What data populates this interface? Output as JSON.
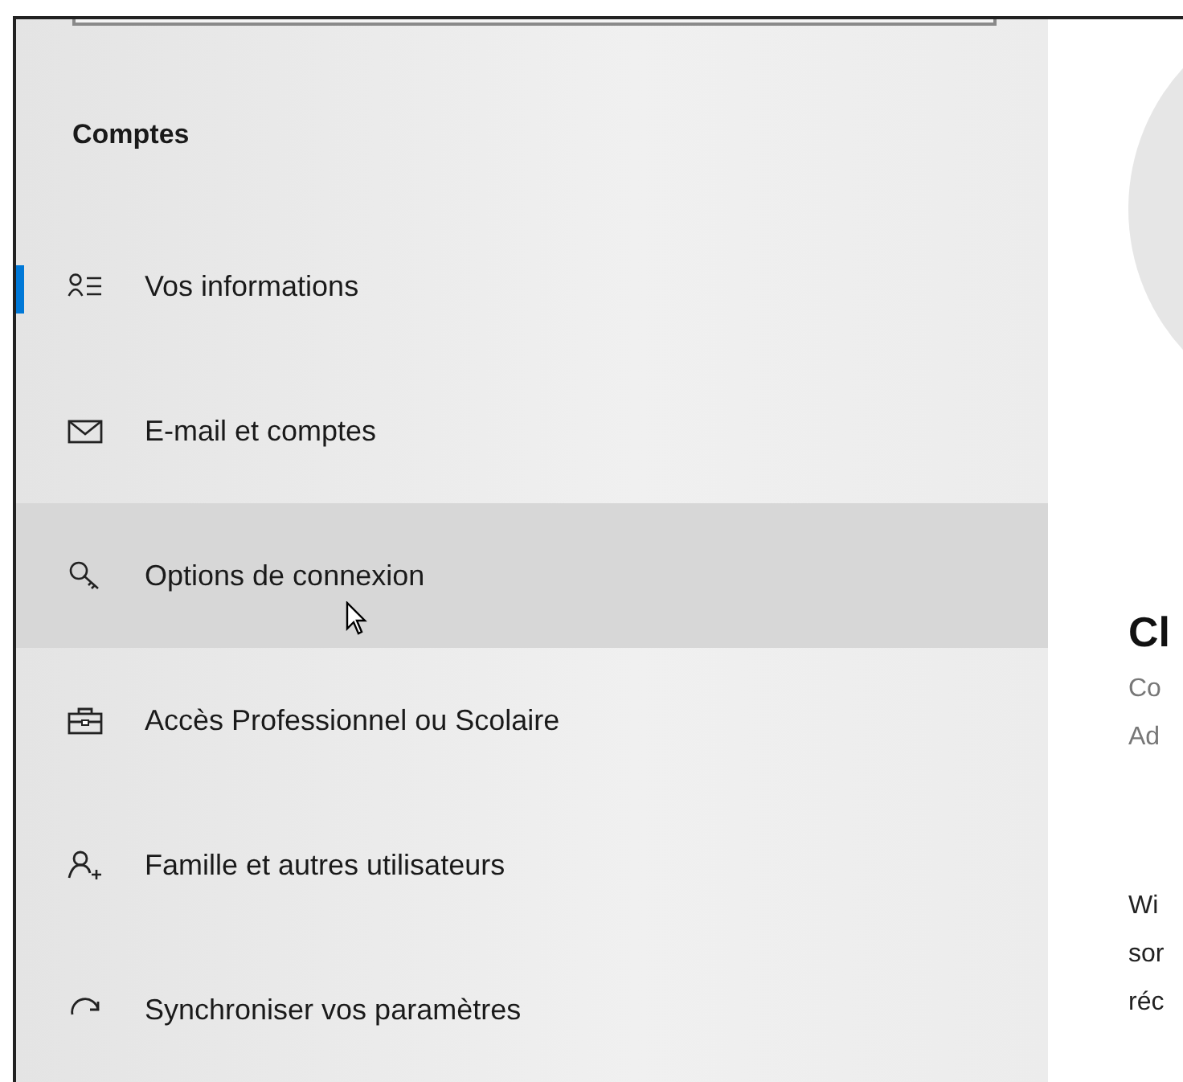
{
  "sidebar": {
    "heading": "Comptes",
    "items": [
      {
        "label": "Vos informations",
        "selected": true,
        "hovered": false
      },
      {
        "label": "E-mail et comptes",
        "selected": false,
        "hovered": false
      },
      {
        "label": "Options de connexion",
        "selected": false,
        "hovered": true
      },
      {
        "label": "Accès Professionnel ou Scolaire",
        "selected": false,
        "hovered": false
      },
      {
        "label": "Famille et autres utilisateurs",
        "selected": false,
        "hovered": false
      },
      {
        "label": "Synchroniser vos paramètres",
        "selected": false,
        "hovered": false
      }
    ]
  },
  "main": {
    "name": "Cl",
    "details": [
      "Co",
      "Ad"
    ],
    "paragraph": [
      "Wi",
      "sor",
      "réc"
    ]
  }
}
